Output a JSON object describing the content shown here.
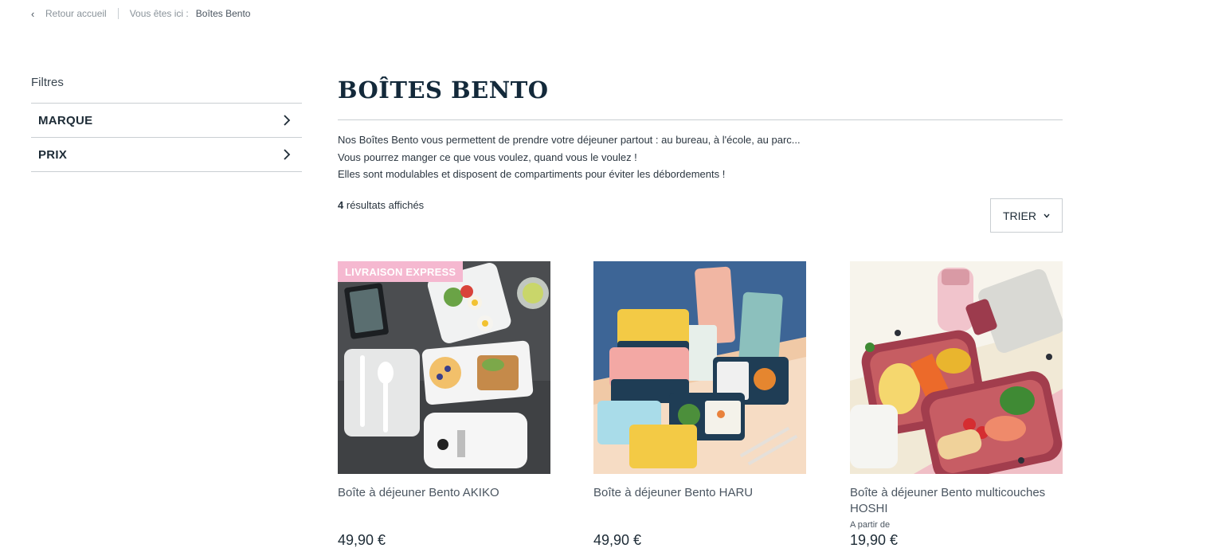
{
  "breadcrumb": {
    "back_label": "Retour accueil",
    "location_prefix": "Vous êtes ici :",
    "current": "Boîtes Bento"
  },
  "filters": {
    "title": "Filtres",
    "items": [
      {
        "label": "MARQUE"
      },
      {
        "label": "PRIX"
      }
    ]
  },
  "page": {
    "title": "BOÎTES BENTO",
    "description": [
      "Nos Boîtes Bento vous permettent de prendre votre déjeuner partout : au bureau, à l'école, au parc...",
      "Vous pourrez manger ce que vous voulez, quand vous le voulez !",
      "Elles sont modulables et disposent de compartiments pour éviter les débordements !"
    ],
    "results_count": "4",
    "results_label": "résultats affichés",
    "sort_label": "TRIER"
  },
  "products": [
    {
      "name": "Boîte à déjeuner Bento AKIKO",
      "price": "49,90 €",
      "badge": "LIVRAISON EXPRESS",
      "price_prefix": ""
    },
    {
      "name": "Boîte à déjeuner Bento HARU",
      "price": "49,90 €",
      "badge": "",
      "price_prefix": ""
    },
    {
      "name": "Boîte à déjeuner Bento multicouches HOSHI",
      "price": "19,90 €",
      "badge": "",
      "price_prefix": "A partir de"
    }
  ],
  "colors": {
    "accent_dark": "#13293a",
    "badge_pink": "#f5b8d0",
    "rule_gray": "#c9ced2"
  }
}
